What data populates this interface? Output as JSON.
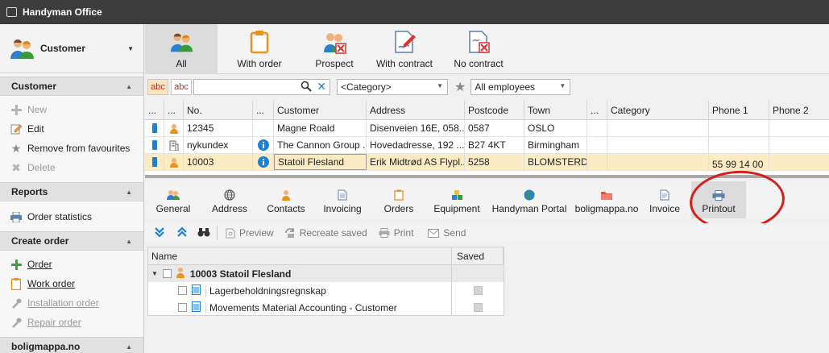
{
  "window": {
    "title": "Handyman Office"
  },
  "module": {
    "label": "Customer"
  },
  "sidebar": {
    "sections": [
      {
        "title": "Customer",
        "items": [
          {
            "label": "New",
            "icon": "plus-icon",
            "disabled": true
          },
          {
            "label": "Edit",
            "icon": "edit-icon",
            "disabled": false
          },
          {
            "label": "Remove from favourites",
            "icon": "star-icon",
            "disabled": false
          },
          {
            "label": "Delete",
            "icon": "delete-icon",
            "disabled": true
          }
        ]
      },
      {
        "title": "Reports",
        "items": [
          {
            "label": "Order statistics",
            "icon": "printer-icon",
            "disabled": false
          }
        ]
      },
      {
        "title": "Create order",
        "items": [
          {
            "label": "Order",
            "icon": "plus-icon",
            "disabled": false
          },
          {
            "label": "Work order",
            "icon": "clipboard-icon",
            "disabled": false
          },
          {
            "label": "Installation order",
            "icon": "wrench-icon",
            "disabled": true
          },
          {
            "label": "Repair order",
            "icon": "wrench-icon",
            "disabled": true
          }
        ]
      },
      {
        "title": "boligmappa.no",
        "items": []
      }
    ]
  },
  "filters": [
    {
      "label": "All",
      "icon": "customers-icon",
      "active": true
    },
    {
      "label": "With order",
      "icon": "clipboard-icon",
      "active": false
    },
    {
      "label": "Prospect",
      "icon": "prospect-icon",
      "active": false
    },
    {
      "label": "With contract",
      "icon": "contract-icon",
      "active": false
    },
    {
      "label": "No contract",
      "icon": "no-contract-icon",
      "active": false
    }
  ],
  "search": {
    "abc1": "abc",
    "abc2": "abc",
    "value": "",
    "category": "<Category>",
    "employees": "All employees"
  },
  "grid": {
    "headers": [
      "...",
      "...",
      "No.",
      "...",
      "Customer",
      "Address",
      "Postcode",
      "Town",
      "...",
      "Category",
      "Phone 1",
      "Phone 2"
    ],
    "rows": [
      {
        "type": "person",
        "info": false,
        "no": "12345",
        "customer": "Magne Roald",
        "address": "Disenveien 16E, 058...",
        "postcode": "0587",
        "town": "OSLO",
        "category": "",
        "phone1": "",
        "phone2": "",
        "selected": false
      },
      {
        "type": "company",
        "info": true,
        "no": "nykundex",
        "customer": "The Cannon Group ...",
        "address": "Hovedadresse, 192 ...",
        "postcode": "B27 4KT",
        "town": "Birmingham",
        "category": "",
        "phone1": "",
        "phone2": "",
        "selected": false
      },
      {
        "type": "person",
        "info": true,
        "no": "10003",
        "customer": "Statoil Flesland",
        "address": "Erik Midtrød AS Flypl...",
        "postcode": "5258",
        "town": "BLOMSTERD...",
        "category": "",
        "phone1": "55 99 14 00",
        "phone2": "",
        "selected": true
      }
    ]
  },
  "detail_tabs": [
    {
      "label": "General",
      "icon": "general-icon"
    },
    {
      "label": "Address",
      "icon": "globe-icon"
    },
    {
      "label": "Contacts",
      "icon": "person-icon"
    },
    {
      "label": "Invoicing",
      "icon": "document-icon"
    },
    {
      "label": "Orders",
      "icon": "clipboard-icon"
    },
    {
      "label": "Equipment",
      "icon": "equipment-icon"
    },
    {
      "label": "Handyman Portal",
      "icon": "portal-globe-icon"
    },
    {
      "label": "boligmappa.no",
      "icon": "folder-icon"
    },
    {
      "label": "Invoice",
      "icon": "invoice-icon"
    },
    {
      "label": "Printout",
      "icon": "printer-icon",
      "active": true
    }
  ],
  "toolbar": {
    "preview": "Preview",
    "recreate": "Recreate saved",
    "print": "Print",
    "send": "Send"
  },
  "printouts": {
    "headers": {
      "name": "Name",
      "saved": "Saved"
    },
    "group": "10003 Statoil Flesland",
    "items": [
      {
        "name": "Lagerbeholdningsregnskap"
      },
      {
        "name": "Movements Material Accounting - Customer"
      }
    ]
  },
  "colors": {
    "accent": "#1e7fd6",
    "selection": "#fdebc4",
    "highlight_circle": "#d3201e"
  }
}
